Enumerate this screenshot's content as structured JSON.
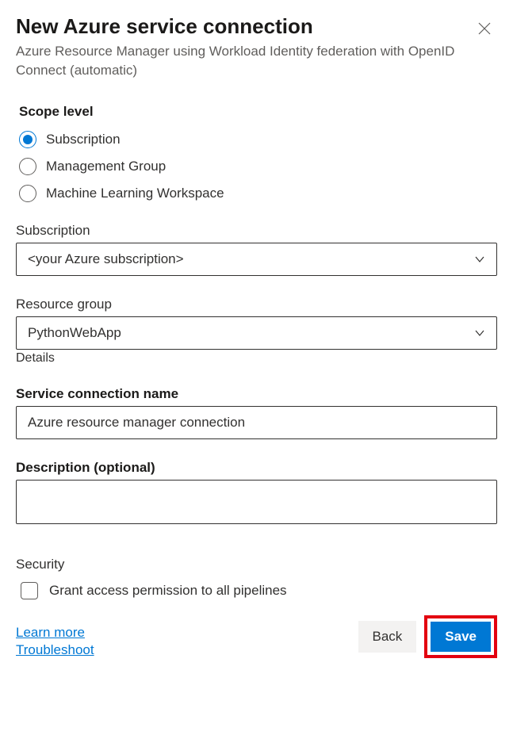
{
  "header": {
    "title": "New Azure service connection",
    "subtitle": "Azure Resource Manager using Workload Identity federation with OpenID Connect (automatic)"
  },
  "scope": {
    "label": "Scope level",
    "options": [
      {
        "label": "Subscription",
        "selected": true
      },
      {
        "label": "Management Group",
        "selected": false
      },
      {
        "label": "Machine Learning Workspace",
        "selected": false
      }
    ]
  },
  "subscription": {
    "label": "Subscription",
    "value": "<your Azure subscription>"
  },
  "resource_group": {
    "label": "Resource group",
    "value": "PythonWebApp",
    "helper": "Details"
  },
  "service_name": {
    "label": "Service connection name",
    "value": "Azure resource manager connection"
  },
  "description": {
    "label": "Description (optional)",
    "value": ""
  },
  "security": {
    "label": "Security",
    "checkbox_label": "Grant access permission to all pipelines"
  },
  "links": {
    "learn_more": "Learn more",
    "troubleshoot": "Troubleshoot"
  },
  "buttons": {
    "back": "Back",
    "save": "Save"
  }
}
